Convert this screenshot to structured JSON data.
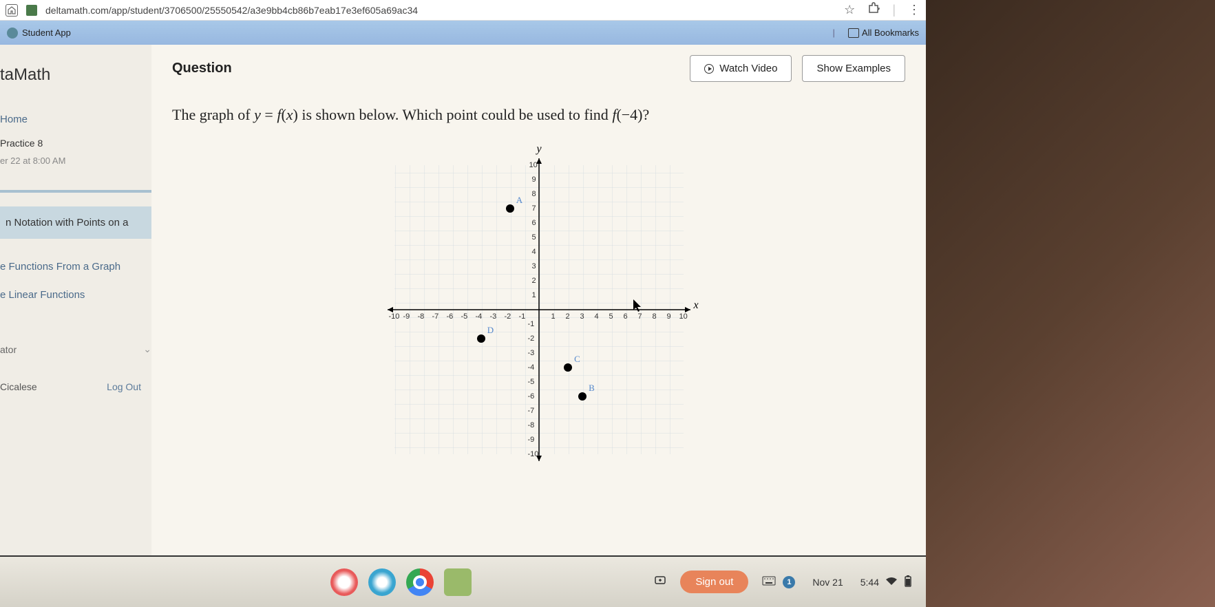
{
  "browser": {
    "url": "deltamath.com/app/student/3706500/25550542/a3e9bb4cb86b7eab17e3ef605a69ac34",
    "bookmarks_bar": {
      "item": "Student App",
      "all_bookmarks": "All Bookmarks"
    }
  },
  "sidebar": {
    "brand": "taMath",
    "items": [
      {
        "label": "Home",
        "type": "link"
      },
      {
        "label": "Practice 8",
        "type": "sub"
      },
      {
        "label": "er 22 at 8:00 AM",
        "type": "meta"
      },
      {
        "label": "n Notation with Points on a",
        "type": "active"
      },
      {
        "label": "e Functions From a Graph",
        "type": "link"
      },
      {
        "label": "e Linear Functions",
        "type": "link"
      }
    ],
    "footer_item": "ator",
    "user": "Cicalese",
    "logout": "Log Out"
  },
  "main": {
    "question_label": "Question",
    "watch_video": "Watch Video",
    "show_examples": "Show Examples",
    "question_prefix": "The graph of ",
    "question_eq1": "y",
    "question_eq2": " = ",
    "question_eq3": "f",
    "question_eq4": "(",
    "question_eq5": "x",
    "question_eq6": ") is shown below. Which point could be used to find ",
    "question_eq7": "f",
    "question_eq8": "(−4)?"
  },
  "chart_data": {
    "type": "scatter",
    "title": "",
    "xlabel": "x",
    "ylabel": "y",
    "xlim": [
      -10,
      10
    ],
    "ylim": [
      -10,
      10
    ],
    "x_ticks": [
      -10,
      -9,
      -8,
      -7,
      -6,
      -5,
      -4,
      -3,
      -2,
      -1,
      1,
      2,
      3,
      4,
      5,
      6,
      7,
      8,
      9,
      10
    ],
    "y_ticks": [
      -10,
      -9,
      -8,
      -7,
      -6,
      -5,
      -4,
      -3,
      -2,
      -1,
      1,
      2,
      3,
      4,
      5,
      6,
      7,
      8,
      9,
      10
    ],
    "points": [
      {
        "name": "A",
        "x": -2,
        "y": 7
      },
      {
        "name": "B",
        "x": 3,
        "y": -6
      },
      {
        "name": "C",
        "x": 2,
        "y": -4
      },
      {
        "name": "D",
        "x": -4,
        "y": -2
      }
    ]
  },
  "taskbar": {
    "signout": "Sign out",
    "date": "Nov 21",
    "time": "5:44"
  }
}
